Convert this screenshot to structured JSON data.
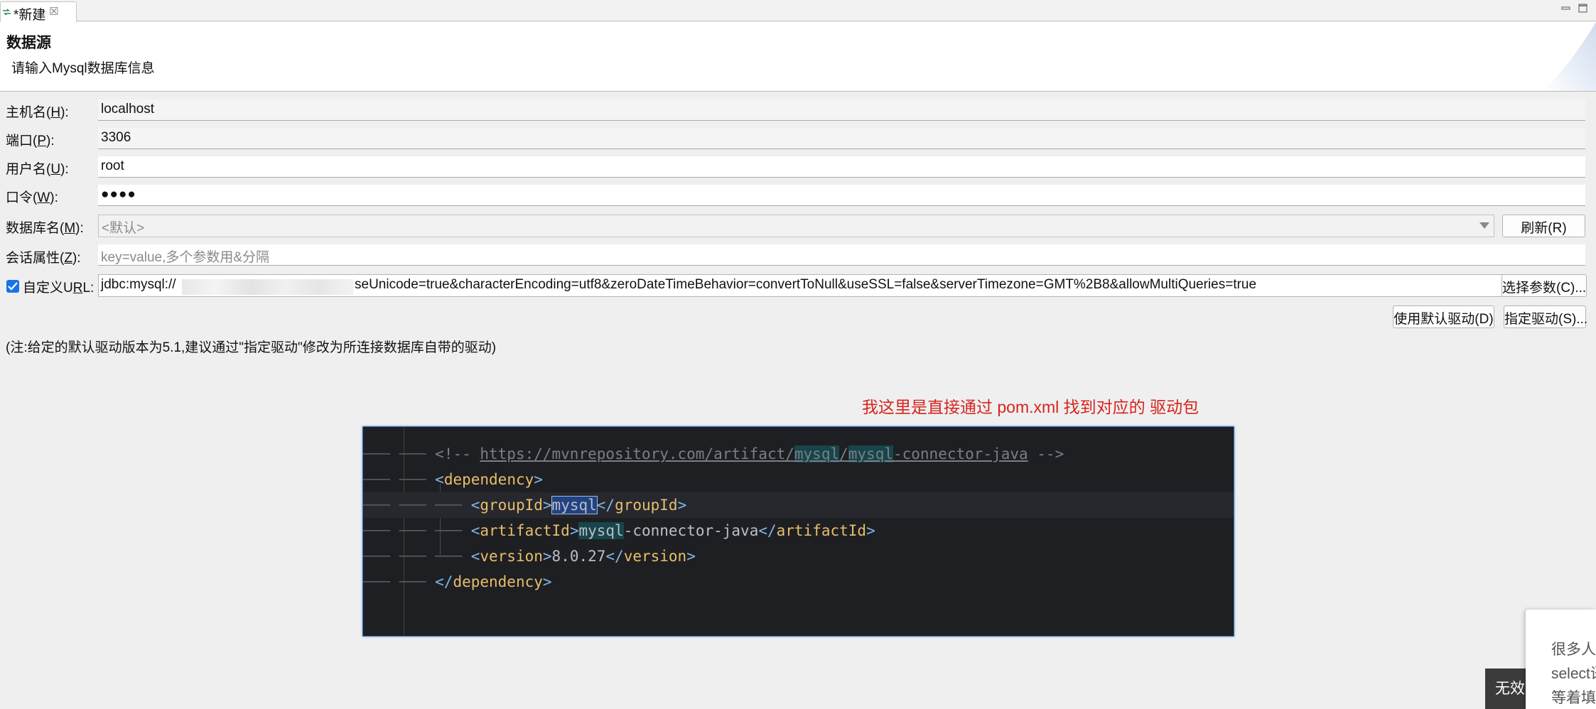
{
  "tab": {
    "label": "*新建",
    "close": "☒"
  },
  "header": {
    "title": "数据源",
    "description": "请输入Mysql数据库信息"
  },
  "form": {
    "host": {
      "label_pre": "主机名(",
      "mnemonic": "H",
      "label_post": "):",
      "value": "localhost"
    },
    "port": {
      "label_pre": "端口(",
      "mnemonic": "P",
      "label_post": "):",
      "value": "3306"
    },
    "user": {
      "label_pre": "用户名(",
      "mnemonic": "U",
      "label_post": "):",
      "value": "root"
    },
    "password": {
      "label_pre": "口令(",
      "mnemonic": "W",
      "label_post": "):",
      "value": "●●●●"
    },
    "database": {
      "label_pre": "数据库名(",
      "mnemonic": "M",
      "label_post": "):",
      "value": "<默认>"
    },
    "session": {
      "label_pre": "会话属性(",
      "mnemonic": "Z",
      "label_post": "):",
      "placeholder": "key=value,多个参数用&分隔"
    },
    "custom_url": {
      "label_pre": "自定义U",
      "mnemonic": "R",
      "label_post": "L:",
      "checked": true,
      "value_prefix": "jdbc:mysql://",
      "value_suffix": "seUnicode=true&characterEncoding=utf8&zeroDateTimeBehavior=convertToNull&useSSL=false&serverTimezone=GMT%2B8&allowMultiQueries=true"
    }
  },
  "buttons": {
    "refresh": "刷新(R)",
    "choose_params": "选择参数(C)...",
    "use_default_driver": "使用默认驱动(D)",
    "set_driver": "指定驱动(S)..."
  },
  "note": "(注:给定的默认驱动版本为5.1,建议通过\"指定驱动\"修改为所连接数据库自带的驱动)",
  "annotation": "我这里是直接通过 pom.xml 找到对应的 驱动包",
  "code": {
    "comment_open": "<!-- ",
    "url_base": "https://mvnrepository.com/artifact/",
    "url_group": "mysql",
    "url_slash": "/",
    "url_artifact_hl": "mysql",
    "url_artifact_rest": "-connector-java",
    "comment_close": " -->",
    "dependency_tag": "dependency",
    "groupId_tag": "groupId",
    "groupId_value": "mysql",
    "artifactId_tag": "artifactId",
    "artifactId_value_hl": "mysql",
    "artifactId_value_rest": "-connector-java",
    "version_tag": "version",
    "version_value": "8.0.27"
  },
  "overlay": {
    "toast_text": "无效",
    "popup_lines": [
      "很多人",
      "select语",
      "等着填"
    ]
  },
  "colors": {
    "accent": "#1a73e8",
    "annotation_red": "#d6231f",
    "code_bg": "#1e1f22",
    "xml_tag": "#e8be6a"
  }
}
